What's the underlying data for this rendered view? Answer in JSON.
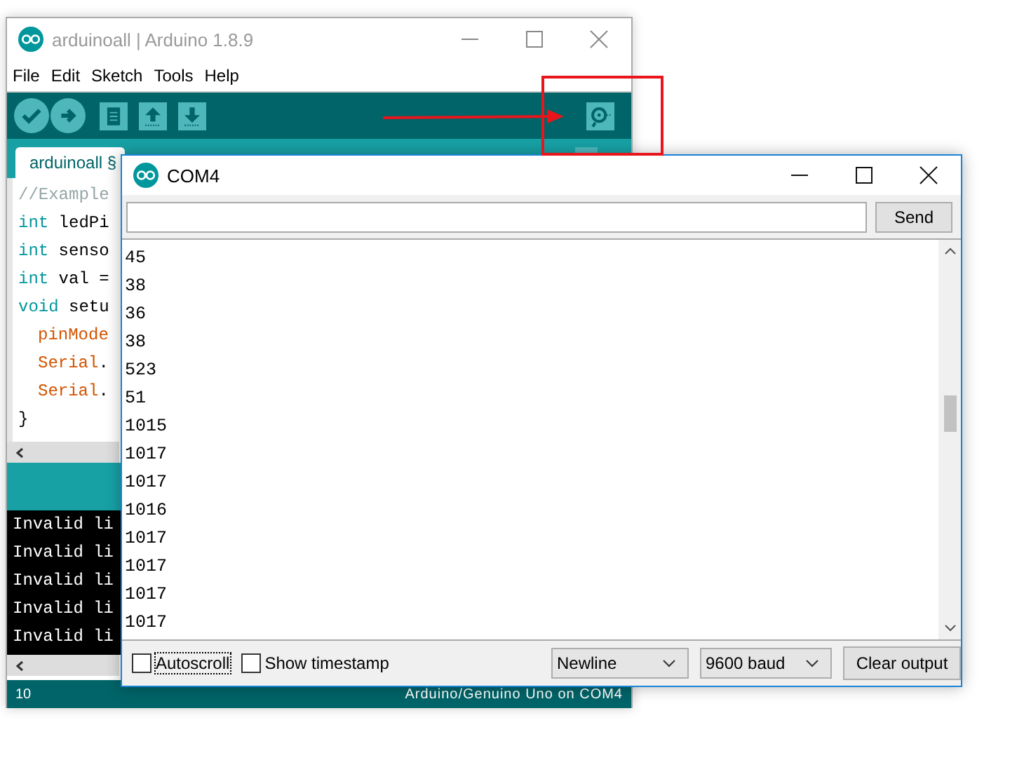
{
  "main_window": {
    "title": "arduinoall | Arduino 1.8.9",
    "menu": [
      "File",
      "Edit",
      "Sketch",
      "Tools",
      "Help"
    ],
    "tab": {
      "label": "arduinoall §",
      "selected": true
    },
    "code_lines": [
      {
        "indented": false,
        "tokens": [
          {
            "kind": "comment",
            "text": "//Example"
          }
        ]
      },
      {
        "indented": false,
        "tokens": [
          {
            "kind": "keyword",
            "text": "int"
          },
          {
            "kind": "plain",
            "text": " ledPi"
          }
        ]
      },
      {
        "indented": false,
        "tokens": [
          {
            "kind": "keyword",
            "text": "int"
          },
          {
            "kind": "plain",
            "text": " senso"
          }
        ]
      },
      {
        "indented": false,
        "tokens": [
          {
            "kind": "keyword",
            "text": "int"
          },
          {
            "kind": "plain",
            "text": " val ="
          }
        ]
      },
      {
        "indented": false,
        "tokens": [
          {
            "kind": "keyword",
            "text": "void"
          },
          {
            "kind": "plain",
            "text": " setu"
          }
        ]
      },
      {
        "indented": true,
        "tokens": [
          {
            "kind": "function",
            "text": "pinMode"
          }
        ]
      },
      {
        "indented": true,
        "tokens": [
          {
            "kind": "function",
            "text": "Serial"
          },
          {
            "kind": "plain",
            "text": "."
          }
        ]
      },
      {
        "indented": true,
        "tokens": [
          {
            "kind": "function",
            "text": "Serial"
          },
          {
            "kind": "plain",
            "text": "."
          }
        ]
      },
      {
        "indented": false,
        "tokens": [
          {
            "kind": "plain",
            "text": "}"
          }
        ]
      }
    ],
    "console_lines": [
      "Invalid li",
      "Invalid li",
      "Invalid li",
      "Invalid li",
      "Invalid li"
    ],
    "status_bar": {
      "line": "10",
      "board": "Arduino/Genuino Uno on COM4"
    }
  },
  "serial_monitor": {
    "title": "COM4",
    "send_button": "Send",
    "output_lines": [
      "45",
      "38",
      "36",
      "38",
      "523",
      "51",
      "1015",
      "1017",
      "1017",
      "1016",
      "1017",
      "1017",
      "1017",
      "1017"
    ],
    "autoscroll": {
      "label": "Autoscroll",
      "checked": false
    },
    "timestamp": {
      "label": "Show timestamp",
      "checked": false
    },
    "line_ending": "Newline",
    "baud": "9600 baud",
    "clear_button": "Clear output"
  }
}
